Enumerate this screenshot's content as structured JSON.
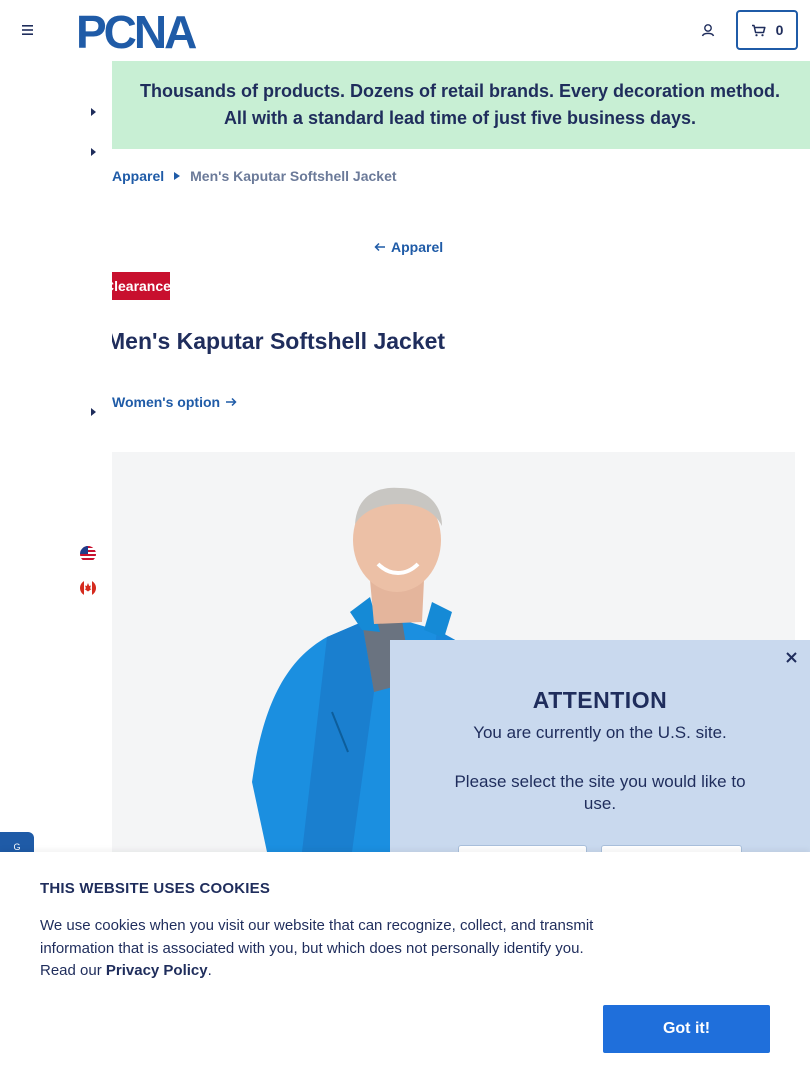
{
  "header": {
    "logo_text": "PCNA",
    "cart_count": "0"
  },
  "promo": {
    "text": "Thousands of products. Dozens of retail brands. Every decoration method. All with a standard lead time of just five business days."
  },
  "breadcrumb": {
    "parent": "Apparel",
    "current": "Men's Kaputar Softshell Jacket"
  },
  "back_link": "Apparel",
  "badge": "Clearance",
  "product": {
    "title": "Men's Kaputar Softshell Jacket",
    "alt_option": "Women's option"
  },
  "side_tab": "G",
  "modal": {
    "title": "ATTENTION",
    "line1": "You are currently on the U.S. site.",
    "line2": "Please select the site you would like to use."
  },
  "cookie": {
    "title": "THIS WEBSITE USES COOKIES",
    "text": "We use cookies when you visit our website that can recognize, collect, and transmit information that is associated with you, but which does not personally identify you. Read our ",
    "link": "Privacy Policy",
    "suffix": ".",
    "button": "Got it!"
  },
  "colors": {
    "navy": "#1f2d5c",
    "brand_blue": "#1f5ba7",
    "promo_green": "#c8efd4",
    "clearance_red": "#c8102e",
    "modal_blue": "#c9d9ee",
    "cta_blue": "#1f6fdb"
  },
  "icons": [
    "hamburger-menu-icon",
    "user-icon",
    "cart-icon",
    "caret-right-icon",
    "arrow-left-icon",
    "arrow-right-icon",
    "us-flag-icon",
    "canada-flag-icon",
    "close-icon"
  ]
}
